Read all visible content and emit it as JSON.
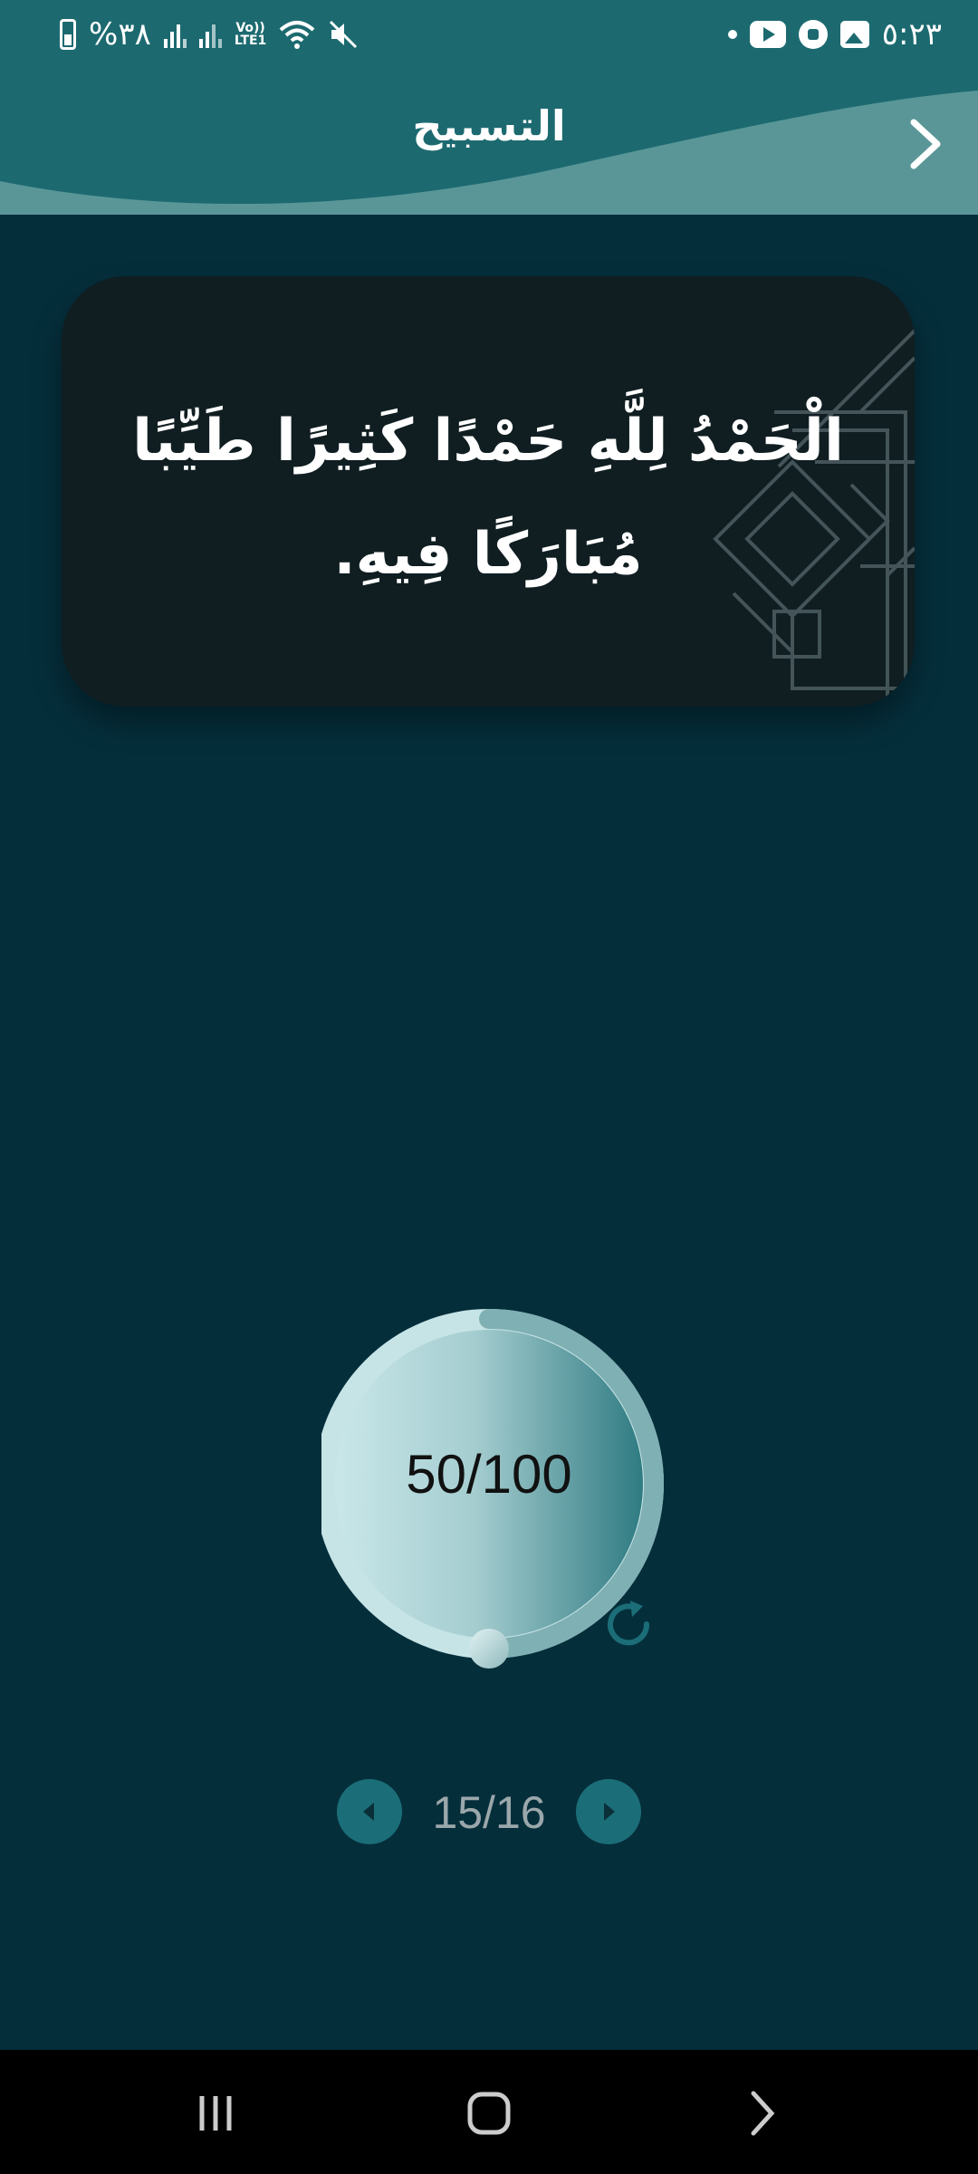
{
  "status_bar": {
    "battery_text": "%٣٨",
    "network_text": "Vo))\nLTE1",
    "time": "٥:٢٣"
  },
  "header": {
    "title": "التسبيح"
  },
  "dhikr": {
    "text": "الْحَمْدُ لِلَّهِ حَمْدًا كَثِيرًا طَيِّبًا مُبَارَكًا فِيهِ."
  },
  "counter": {
    "display": "50/100",
    "current": 50,
    "total": 100,
    "progress_fraction": 0.5
  },
  "pager": {
    "display": "15/16"
  },
  "colors": {
    "background": "#052e3b",
    "header": "#1c6a70",
    "accent": "#1b6e78",
    "card": "#101e22"
  },
  "icons": {
    "back": "chevron-right-icon",
    "reset": "refresh-icon",
    "prev": "triangle-left-icon",
    "next": "triangle-right-icon"
  }
}
